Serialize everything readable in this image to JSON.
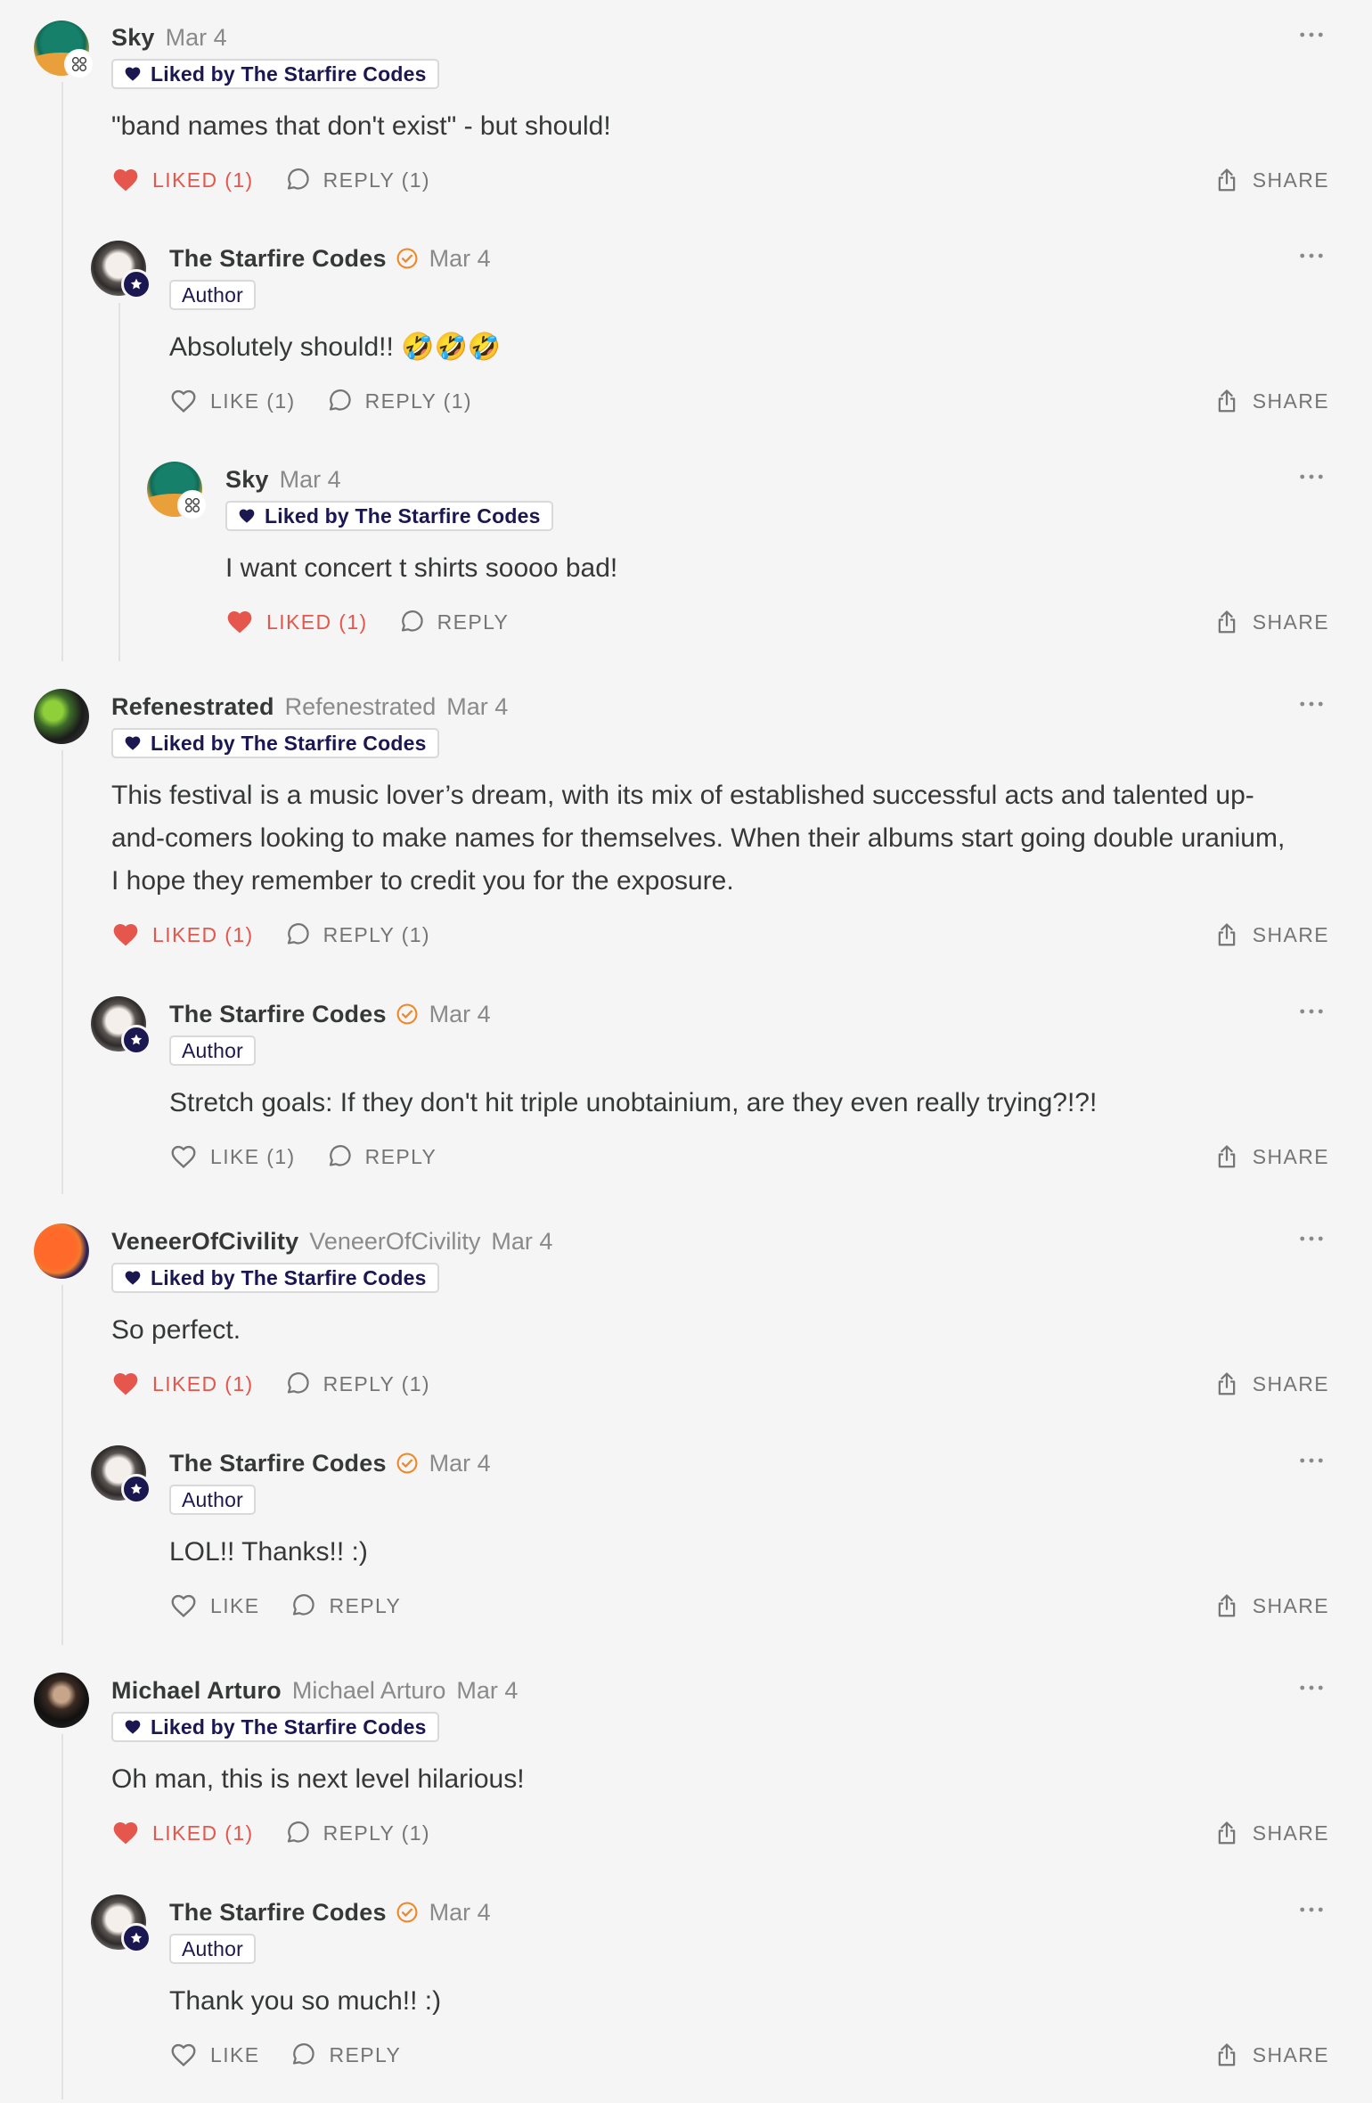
{
  "actions": {
    "like": "LIKE",
    "liked": "LIKED",
    "reply": "REPLY",
    "share": "SHARE"
  },
  "colors": {
    "background": "#f5f5f5",
    "liked": "#e5564c",
    "badge_navy": "#1b1751",
    "verified": "#ef8a2c"
  },
  "comments": [
    {
      "name": "Sky",
      "handle": "",
      "date": "Mar 4",
      "badge": "Liked by The Starfire Codes",
      "text": "\"band names that don't exist\" - but should!",
      "like_label": "LIKED (1)",
      "reply_label": "REPLY (1)",
      "liked": true,
      "avatar": "sky-avatar"
    },
    {
      "name": "The Starfire Codes",
      "handle": "",
      "date": "Mar 4",
      "badge": "Author",
      "text": "Absolutely should!! 🤣🤣🤣",
      "like_label": "LIKE (1)",
      "reply_label": "REPLY (1)",
      "liked": false,
      "avatar": "author-avatar"
    },
    {
      "name": "Sky",
      "handle": "",
      "date": "Mar 4",
      "badge": "Liked by The Starfire Codes",
      "text": "I want concert t shirts soooo bad!",
      "like_label": "LIKED (1)",
      "reply_label": "REPLY",
      "liked": true,
      "avatar": "sky-avatar"
    },
    {
      "name": "Refenestrated",
      "handle": "Refenestrated",
      "date": "Mar 4",
      "badge": "Liked by The Starfire Codes",
      "text_lines": [
        "This festival is a music lover’s dream, with its mix of established successful acts and talented up-",
        "and-comers looking to make names for themselves. When their albums start going double uranium,",
        "I hope they remember to credit you for the exposure."
      ],
      "like_label": "LIKED (1)",
      "reply_label": "REPLY (1)",
      "liked": true,
      "avatar": "refenestrated-avatar"
    },
    {
      "name": "The Starfire Codes",
      "handle": "",
      "date": "Mar 4",
      "badge": "Author",
      "text": "Stretch goals: If they don't hit triple unobtainium, are they even really trying?!?!",
      "like_label": "LIKE (1)",
      "reply_label": "REPLY",
      "liked": false,
      "avatar": "author-avatar"
    },
    {
      "name": "VeneerOfCivility",
      "handle": "VeneerOfCivility",
      "date": "Mar 4",
      "badge": "Liked by The Starfire Codes",
      "text": "So perfect.",
      "like_label": "LIKED (1)",
      "reply_label": "REPLY (1)",
      "liked": true,
      "avatar": "veneer-avatar"
    },
    {
      "name": "The Starfire Codes",
      "handle": "",
      "date": "Mar 4",
      "badge": "Author",
      "text": "LOL!! Thanks!! :)",
      "like_label": "LIKE",
      "reply_label": "REPLY",
      "liked": false,
      "avatar": "author-avatar"
    },
    {
      "name": "Michael Arturo",
      "handle": "Michael Arturo",
      "date": "Mar 4",
      "badge": "Liked by The Starfire Codes",
      "text": "Oh man, this is next level hilarious!",
      "like_label": "LIKED (1)",
      "reply_label": "REPLY (1)",
      "liked": true,
      "avatar": "michael-avatar"
    },
    {
      "name": "The Starfire Codes",
      "handle": "",
      "date": "Mar 4",
      "badge": "Author",
      "text": "Thank you so much!! :)",
      "like_label": "LIKE",
      "reply_label": "REPLY",
      "liked": false,
      "avatar": "author-avatar"
    }
  ]
}
